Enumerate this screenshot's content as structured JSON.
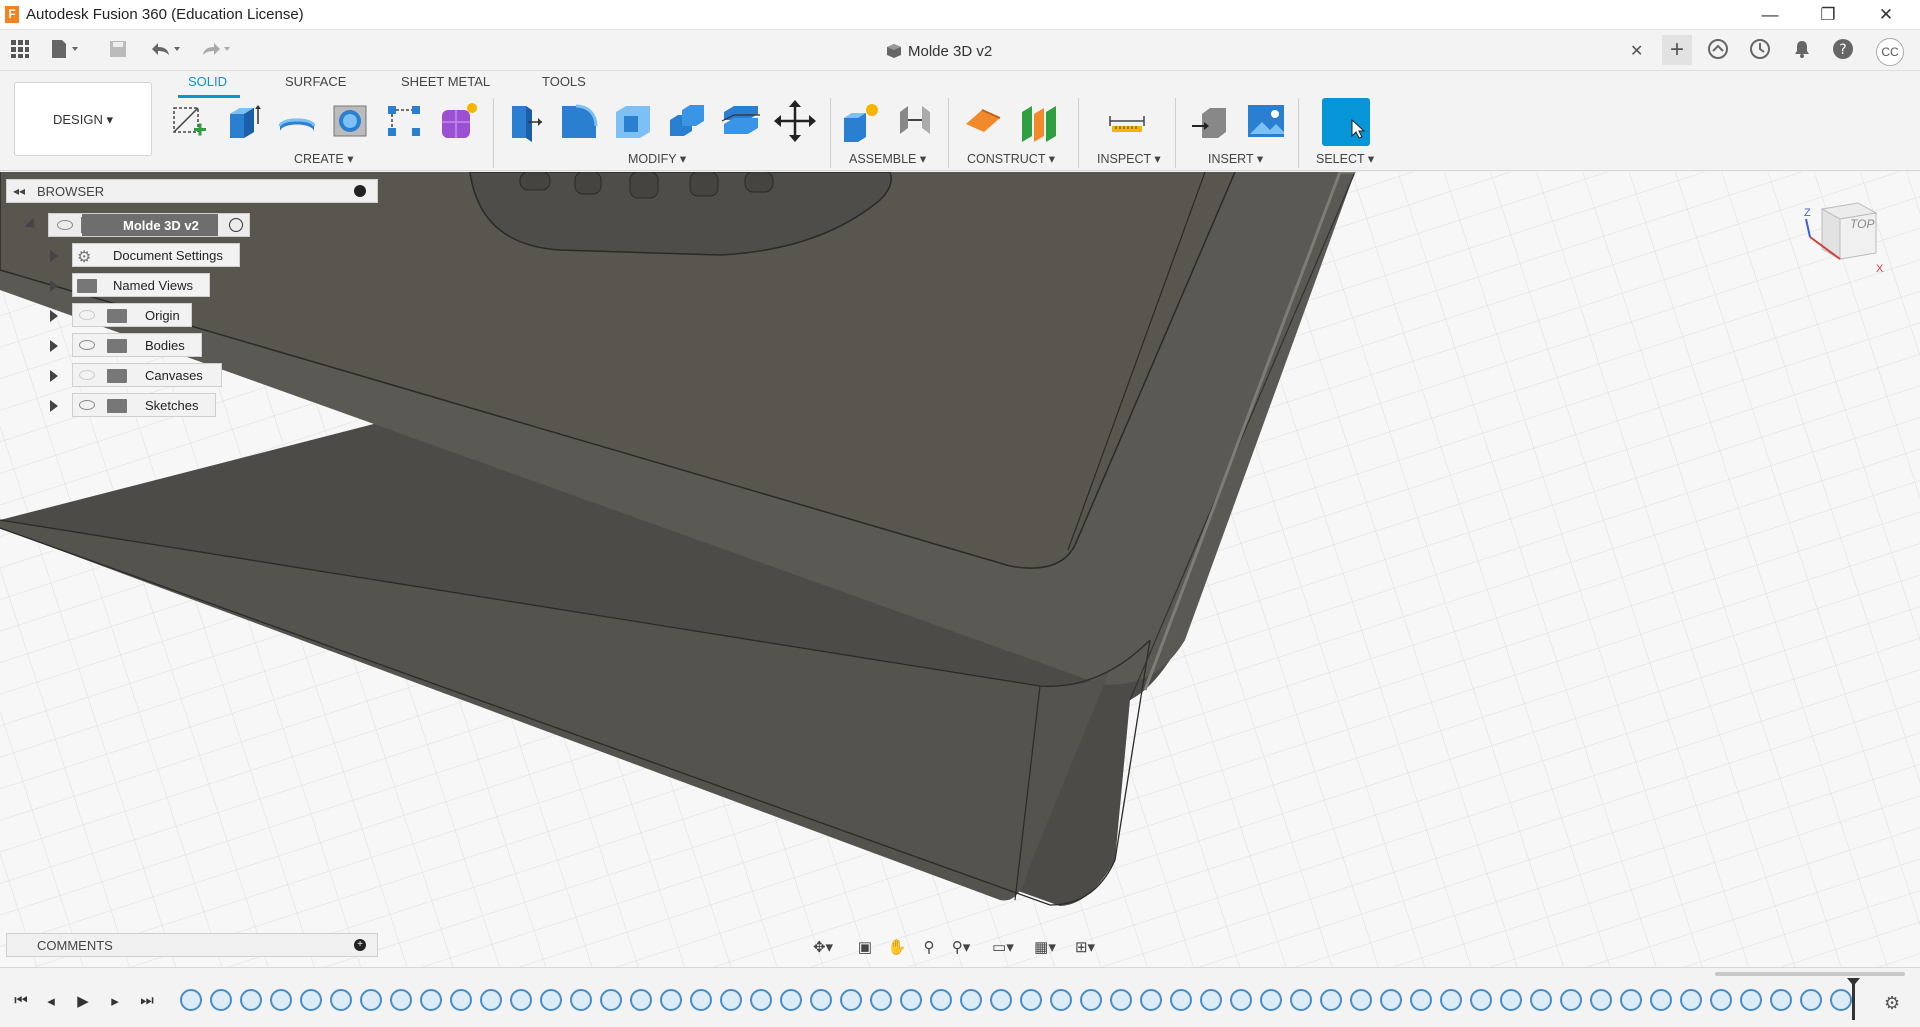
{
  "window": {
    "title": "Autodesk Fusion 360 (Education License)",
    "app_icon_letter": "F",
    "controls": {
      "minimize": "—",
      "restore": "❐",
      "close": "✕"
    }
  },
  "document": {
    "tab_title": "Molde 3D v2",
    "tab_close": "✕",
    "new_tab": "+"
  },
  "account": {
    "initials": "CC"
  },
  "toolbar": {
    "workspace": "DESIGN ▾",
    "tabs": [
      "SOLID",
      "SURFACE",
      "SHEET METAL",
      "TOOLS"
    ],
    "active_tab": "SOLID",
    "groups": {
      "create": "CREATE ▾",
      "modify": "MODIFY ▾",
      "assemble": "ASSEMBLE ▾",
      "construct": "CONSTRUCT ▾",
      "inspect": "INSPECT ▾",
      "insert": "INSERT ▾",
      "select": "SELECT ▾"
    }
  },
  "browser": {
    "header": "BROWSER",
    "root": "Molde 3D v2",
    "items": [
      {
        "label": "Document Settings"
      },
      {
        "label": "Named Views"
      },
      {
        "label": "Origin"
      },
      {
        "label": "Bodies"
      },
      {
        "label": "Canvases"
      },
      {
        "label": "Sketches"
      }
    ]
  },
  "comments": {
    "header": "COMMENTS"
  },
  "viewcube": {
    "face": "TOP",
    "axis_x": "X",
    "axis_z": "Z"
  },
  "colors": {
    "accent": "#0696d7",
    "model": "#5a5853",
    "model_dark": "#4a4945",
    "grid": "#dcdcdc"
  }
}
